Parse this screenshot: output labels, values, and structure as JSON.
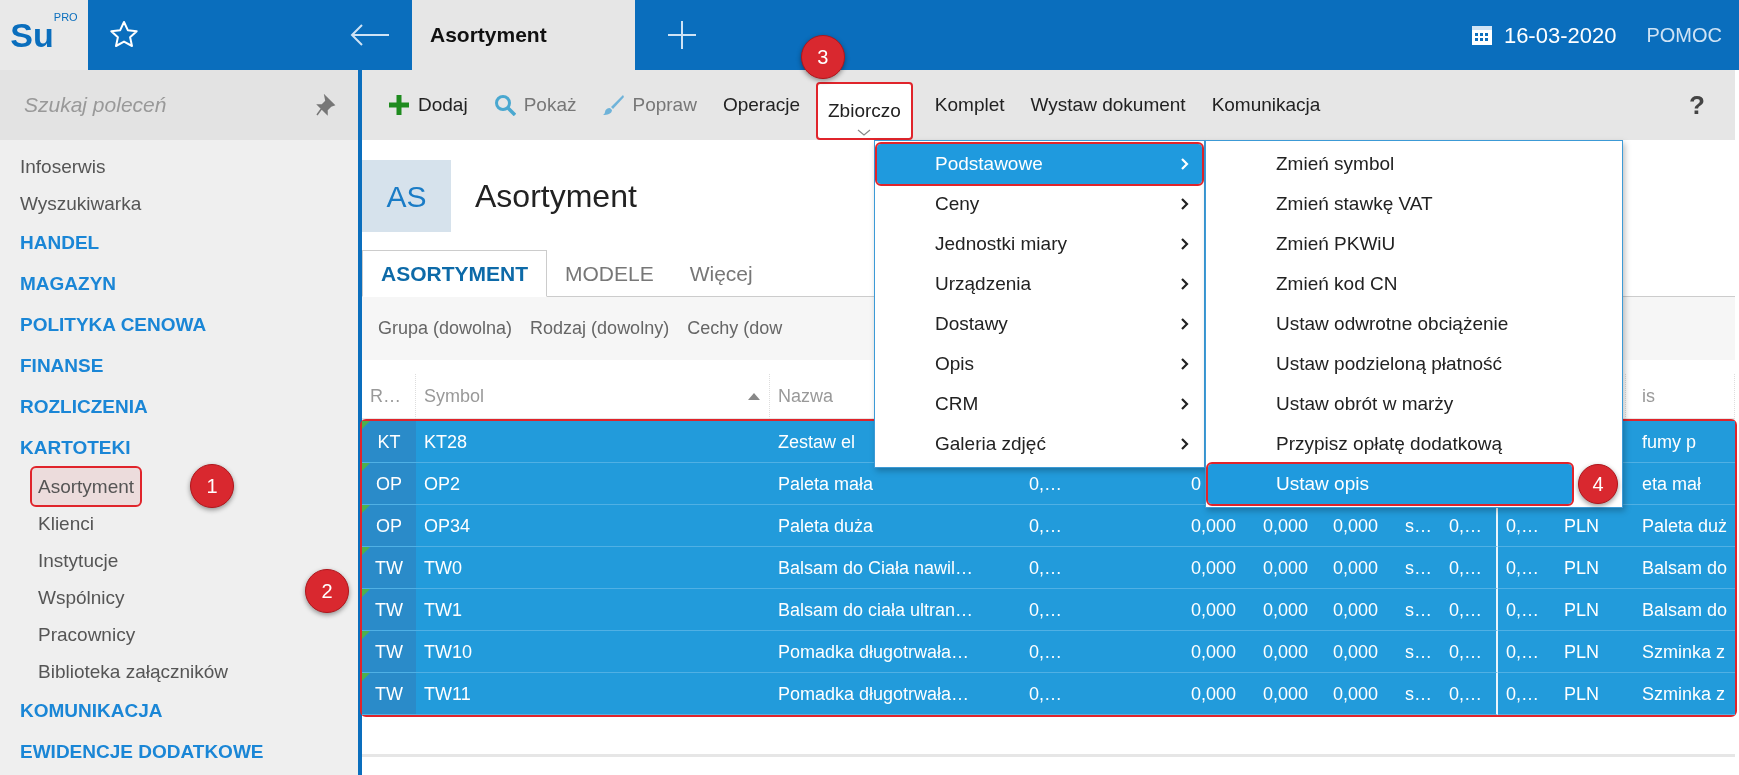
{
  "topbar": {
    "logo": {
      "text": "Su",
      "superscript": "PRO"
    },
    "tabs": [
      {
        "label": "Asortyment",
        "selected": true
      }
    ],
    "date": "16-03-2020",
    "help_link": "POMOC"
  },
  "sidebar": {
    "search": {
      "placeholder": "Szukaj poleceń"
    },
    "items": [
      {
        "label": "Infoserwis",
        "kind": "link"
      },
      {
        "label": "Wyszukiwarka",
        "kind": "link"
      },
      {
        "label": "HANDEL",
        "kind": "section"
      },
      {
        "label": "MAGAZYN",
        "kind": "section"
      },
      {
        "label": "POLITYKA CENOWA",
        "kind": "section"
      },
      {
        "label": "FINANSE",
        "kind": "section"
      },
      {
        "label": "ROZLICZENIA",
        "kind": "section"
      },
      {
        "label": "KARTOTEKI",
        "kind": "section",
        "children": [
          {
            "label": "Asortyment",
            "selected": true,
            "callout": "1"
          },
          {
            "label": "Klienci",
            "selected": false
          },
          {
            "label": "Instytucje",
            "selected": false
          },
          {
            "label": "Wspólnicy",
            "selected": false
          },
          {
            "label": "Pracownicy",
            "selected": false
          },
          {
            "label": "Biblioteka załączników",
            "selected": false
          }
        ]
      },
      {
        "label": "KOMUNIKACJA",
        "kind": "section"
      },
      {
        "label": "EWIDENCJE DODATKOWE",
        "kind": "section"
      }
    ]
  },
  "toolbar": {
    "items": [
      {
        "label": "Dodaj",
        "disabled": false,
        "open": false
      },
      {
        "label": "Pokaż",
        "disabled": true,
        "open": false
      },
      {
        "label": "Popraw",
        "disabled": true,
        "open": false
      },
      {
        "label": "Operacje",
        "disabled": false,
        "open": false
      },
      {
        "label": "Zbiorczo",
        "disabled": false,
        "open": true,
        "callout": "3"
      },
      {
        "label": "Komplet",
        "disabled": false,
        "open": false
      },
      {
        "label": "Wystaw dokument",
        "disabled": false,
        "open": false
      },
      {
        "label": "Komunikacja",
        "disabled": false,
        "open": false
      }
    ],
    "help": "?"
  },
  "header": {
    "badge": "AS",
    "title": "Asortyment"
  },
  "tabs": [
    {
      "label": "ASORTYMENT",
      "selected": true
    },
    {
      "label": "MODELE",
      "selected": false
    },
    {
      "label": "Więcej",
      "selected": false
    }
  ],
  "filters": [
    "Grupa (dowolna)",
    "Rodzaj (dowolny)",
    "Cechy (dow"
  ],
  "table": {
    "callout": "2",
    "columns": [
      {
        "label": "R…",
        "sorted": false
      },
      {
        "label": "Symbol",
        "sorted": true
      },
      {
        "label": "Nazwa",
        "sorted": false
      },
      null,
      null,
      null,
      null,
      null,
      null,
      null,
      null,
      null,
      {
        "label": "is",
        "sorted": false
      }
    ],
    "rows": [
      {
        "selected": true,
        "flagged": true,
        "cells": [
          "KT",
          "KT28",
          "Zestaw el",
          null,
          null,
          null,
          null,
          null,
          null,
          null,
          null,
          null,
          "fumy p"
        ]
      },
      {
        "selected": true,
        "flagged": true,
        "cells": [
          "OP",
          "OP2",
          "Paleta mała",
          "0,…",
          null,
          "0",
          null,
          null,
          null,
          null,
          null,
          null,
          "eta mał"
        ]
      },
      {
        "selected": true,
        "flagged": true,
        "cells": [
          "OP",
          "OP34",
          "Paleta duża",
          "0,…",
          null,
          "0,000",
          "0,000",
          "0,000",
          "s…",
          "0,…",
          "0,…",
          "PLN",
          "Paleta duż"
        ]
      },
      {
        "selected": true,
        "flagged": true,
        "cells": [
          "TW",
          "TW0",
          "Balsam do Ciała nawil…",
          "0,…",
          null,
          "0,000",
          "0,000",
          "0,000",
          "s…",
          "0,…",
          "0,…",
          "PLN",
          "Balsam do"
        ]
      },
      {
        "selected": true,
        "flagged": true,
        "cells": [
          "TW",
          "TW1",
          "Balsam do ciała ultran…",
          "0,…",
          null,
          "0,000",
          "0,000",
          "0,000",
          "s…",
          "0,…",
          "0,…",
          "PLN",
          "Balsam do"
        ]
      },
      {
        "selected": true,
        "flagged": true,
        "cells": [
          "TW",
          "TW10",
          "Pomadka długotrwała…",
          "0,…",
          null,
          "0,000",
          "0,000",
          "0,000",
          "s…",
          "0,…",
          "0,…",
          "PLN",
          "Szminka z"
        ]
      },
      {
        "selected": true,
        "flagged": true,
        "cells": [
          "TW",
          "TW11",
          "Pomadka długotrwała…",
          "0,…",
          null,
          "0,000",
          "0,000",
          "0,000",
          "s…",
          "0,…",
          "0,…",
          "PLN",
          "Szminka z"
        ]
      }
    ]
  },
  "menu": {
    "items": [
      {
        "label": "Podstawowe",
        "selected": true,
        "outlined": true
      },
      {
        "label": "Ceny",
        "selected": false,
        "outlined": false
      },
      {
        "label": "Jednostki miary",
        "selected": false,
        "outlined": false
      },
      {
        "label": "Urządzenia",
        "selected": false,
        "outlined": false
      },
      {
        "label": "Dostawy",
        "selected": false,
        "outlined": false
      },
      {
        "label": "Opis",
        "selected": false,
        "outlined": false
      },
      {
        "label": "CRM",
        "selected": false,
        "outlined": false
      },
      {
        "label": "Galeria zdjęć",
        "selected": false,
        "outlined": false
      }
    ]
  },
  "submenu": {
    "items": [
      {
        "label": "Zmień symbol",
        "selected": false,
        "outlined": false
      },
      {
        "label": "Zmień stawkę VAT",
        "selected": false,
        "outlined": false
      },
      {
        "label": "Zmień PKWiU",
        "selected": false,
        "outlined": false
      },
      {
        "label": "Zmień kod CN",
        "selected": false,
        "outlined": false
      },
      {
        "label": "Ustaw odwrotne obciążenie",
        "selected": false,
        "outlined": false
      },
      {
        "label": "Ustaw podzieloną płatność",
        "selected": false,
        "outlined": false
      },
      {
        "label": "Ustaw obrót w marży",
        "selected": false,
        "outlined": false
      },
      {
        "label": "Przypisz opłatę dodatkową",
        "selected": false,
        "outlined": false
      },
      {
        "label": "Ustaw opis",
        "selected": true,
        "outlined": true,
        "callout": "4"
      }
    ]
  }
}
